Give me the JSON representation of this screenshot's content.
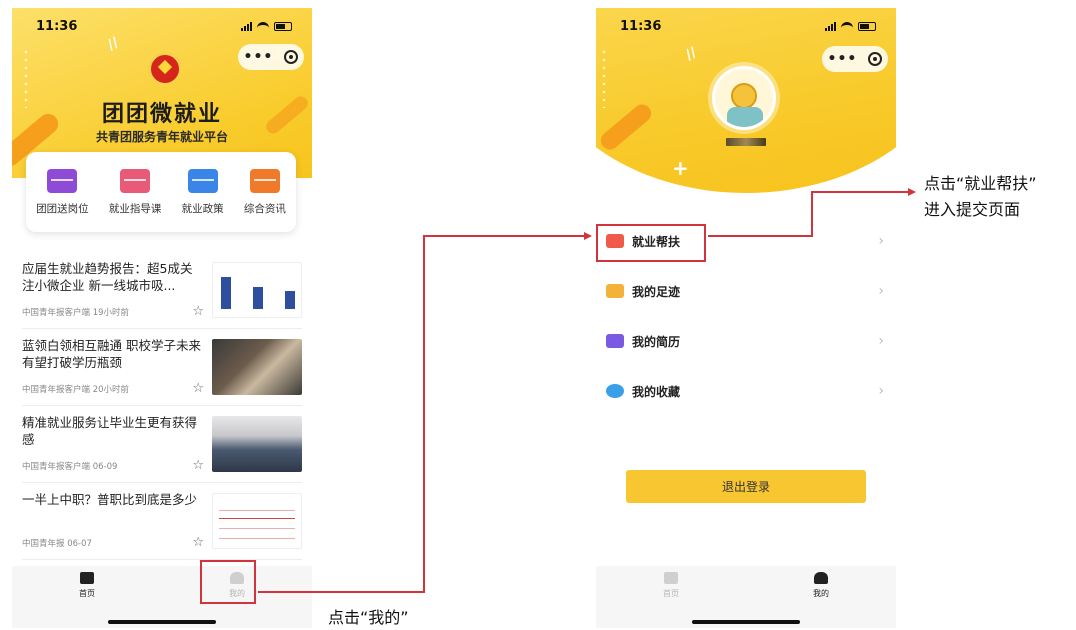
{
  "home": {
    "status_time": "11:36",
    "title": "团团微就业",
    "subtitle": "共青团服务青年就业平台",
    "quick_links": [
      {
        "label": "团团送岗位",
        "icon": "briefcase-icon",
        "color": "#8e4bd6"
      },
      {
        "label": "就业指导课",
        "icon": "book-icon",
        "color": "#e85a78"
      },
      {
        "label": "就业政策",
        "icon": "policy-icon",
        "color": "#3a86e8"
      },
      {
        "label": "综合资讯",
        "icon": "news-icon",
        "color": "#f07a2a"
      }
    ],
    "news": [
      {
        "title": "应届生就业趋势报告：超5成关注小微企业 新一线城市吸...",
        "source": "中国青年报客户端  19小时前"
      },
      {
        "title": "蓝领白领相互融通 职校学子未来有望打破学历瓶颈",
        "source": "中国青年报客户端  20小时前"
      },
      {
        "title": "精准就业服务让毕业生更有获得感",
        "source": "中国青年报客户端  06-09"
      },
      {
        "title": "一半上中职？普职比到底是多少",
        "source": "中国青年报  06-07"
      }
    ],
    "tabs": [
      {
        "label": "首页",
        "active": true
      },
      {
        "label": "我的",
        "active": false
      }
    ]
  },
  "me": {
    "status_time": "11:36",
    "menu": [
      {
        "label": "就业帮扶",
        "icon": "help-briefcase-icon",
        "color": "#f05a4a"
      },
      {
        "label": "我的足迹",
        "icon": "footprint-icon",
        "color": "#f3b238"
      },
      {
        "label": "我的简历",
        "icon": "resume-icon",
        "color": "#7a5ae0"
      },
      {
        "label": "我的收藏",
        "icon": "favorite-star-icon",
        "color": "#3a9ee8"
      }
    ],
    "logout_label": "退出登录",
    "tabs": [
      {
        "label": "首页",
        "active": false
      },
      {
        "label": "我的",
        "active": true
      }
    ]
  },
  "annotations": {
    "click_me": "点击“我的”",
    "click_help_line1": "点击“就业帮扶”",
    "click_help_line2": "进入提交页面",
    "highlight_color": "#d0343c"
  }
}
